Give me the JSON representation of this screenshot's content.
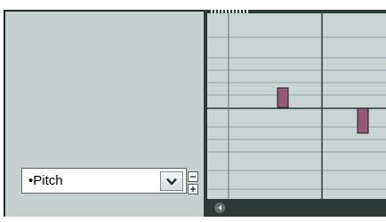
{
  "lane": {
    "selected_label": "•Pitch",
    "dropdown_icon": "chevron-down-icon",
    "collapse_icon": "minus-icon",
    "expand_icon": "plus-icon"
  },
  "colors": {
    "lane_background": "#c6d1cf",
    "grid_background": "#c9d5d3",
    "grid_dark_line": "#2b3a37",
    "grid_light_line": "#7e928f",
    "note_fill": "#96597a",
    "frame_dark": "#2a3b38"
  },
  "notes": [
    {
      "label": "note-1",
      "color": "#96597a"
    },
    {
      "label": "note-2",
      "color": "#96597a"
    }
  ]
}
